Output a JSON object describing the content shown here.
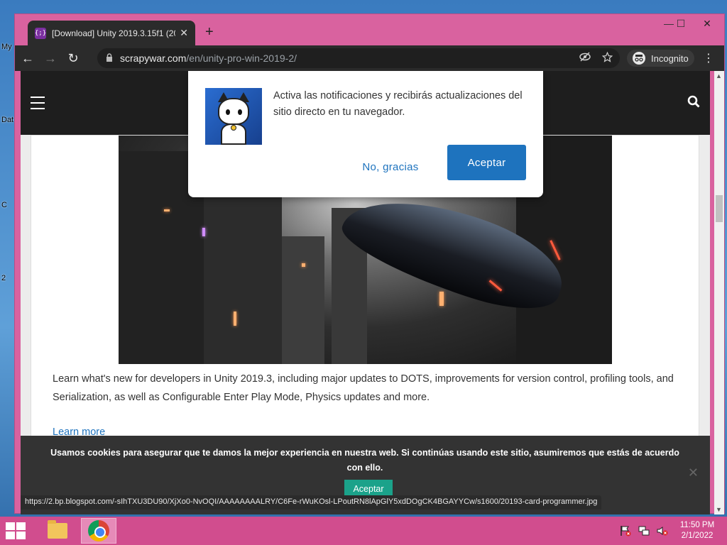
{
  "desktop": {
    "labels": [
      "My",
      "Dat",
      "C",
      "2"
    ]
  },
  "browser": {
    "tab": {
      "favicon": "{;}",
      "title": "[Download] Unity 2019.3.15f1 (20",
      "close": "✕"
    },
    "new_tab": "+",
    "window_controls": {
      "minimize": "—",
      "maximize": "☐",
      "close": "✕"
    },
    "nav": {
      "back": "←",
      "forward": "→",
      "reload": "↻"
    },
    "url": {
      "host": "scrapywar.com",
      "path": "/en/unity-pro-win-2019-2/"
    },
    "incognito_label": "Incognito",
    "menu": "⋮",
    "status_url": "https://2.bp.blogspot.com/-sIhTXU3DU90/XjXo0-NvOQI/AAAAAAAALRY/C6Fe-rWuKOsl-LPoutRN8lApGlY5xdDOgCK4BGAYYCw/s1600/20193-card-programmer.jpg"
  },
  "page": {
    "body_text": "Learn what's new for developers in Unity 2019.3, including major updates to DOTS, improvements for version control, profiling tools, and Serialization, as well as Configurable Enter Play Mode, Physics updates and more.",
    "learn_more": "Learn more"
  },
  "notification": {
    "text": "Activa las notificaciones y recibirás actualizaciones del sitio directo en tu navegador.",
    "decline": "No, gracias",
    "accept": "Aceptar"
  },
  "cookie_bar": {
    "text": "Usamos cookies para asegurar que te damos la mejor experiencia en nuestra web. Si continúas usando este sitio, asumiremos que estás de acuerdo con ello.",
    "accept": "Aceptar",
    "close": "✕"
  },
  "taskbar": {
    "time": "11:50 PM",
    "date": "2/1/2022"
  },
  "colors": {
    "window_frame": "#d9629f",
    "taskbar": "#d14d8e",
    "link": "#1e73be",
    "cookie_button": "#1ba28a"
  }
}
